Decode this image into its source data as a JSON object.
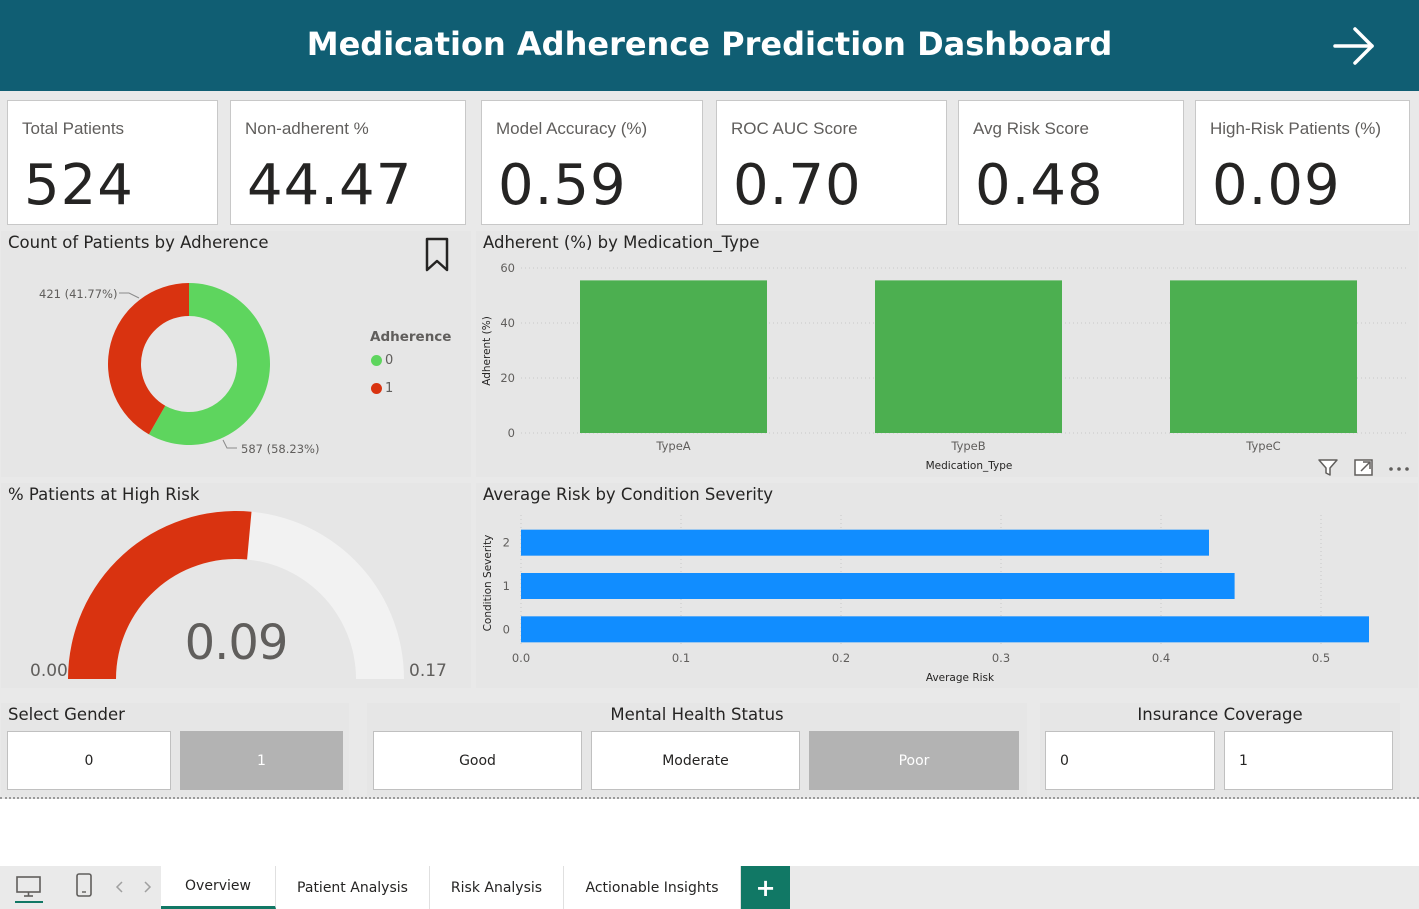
{
  "header": {
    "title": "Medication Adherence Prediction Dashboard"
  },
  "kpis": [
    {
      "label": "Total Patients",
      "value": "524"
    },
    {
      "label": "Non-adherent %",
      "value": "44.47"
    },
    {
      "label": "Model Accuracy (%)",
      "value": "0.59"
    },
    {
      "label": "ROC AUC Score",
      "value": "0.70"
    },
    {
      "label": "Avg Risk Score",
      "value": "0.48"
    },
    {
      "label": "High-Risk Patients (%)",
      "value": "0.09"
    }
  ],
  "donut": {
    "title": "Count of Patients by Adherence",
    "legend_title": "Adherence",
    "label_1": "421 (41.77%)",
    "label_0": "587 (58.23%)",
    "colors": {
      "0": "#5ed55e",
      "1": "#d93310"
    }
  },
  "gauge": {
    "title": "% Patients at High Risk",
    "value_text": "0.09",
    "min_text": "0.00",
    "max_text": "0.17"
  },
  "slicers": {
    "gender": {
      "title": "Select Gender",
      "options": [
        "0",
        "1"
      ],
      "selected": "1"
    },
    "mental": {
      "title": "Mental Health Status",
      "options": [
        "Good",
        "Moderate",
        "Poor"
      ],
      "selected": "Poor"
    },
    "insurance": {
      "title": "Insurance Coverage",
      "options": [
        "0",
        "1"
      ],
      "selected": ""
    }
  },
  "tabs": {
    "overview": "Overview",
    "patient": "Patient Analysis",
    "risk": "Risk Analysis",
    "insights": "Actionable Insights",
    "add": "+"
  },
  "icons": [
    "arrow-right-icon",
    "bookmark-icon",
    "filter-icon",
    "focus-mode-icon",
    "more-options-icon",
    "desktop-icon",
    "phone-icon",
    "chevron-left-icon",
    "chevron-right-icon"
  ],
  "chart_data": [
    {
      "type": "pie",
      "title": "Count of Patients by Adherence",
      "categories": [
        "0",
        "1"
      ],
      "values": [
        587,
        421
      ],
      "percent": [
        58.23,
        41.77
      ],
      "legend": "right",
      "colors": [
        "#5ed55e",
        "#d93310"
      ]
    },
    {
      "type": "bar",
      "title": "Adherent (%) by Medication_Type",
      "categories": [
        "TypeA",
        "TypeB",
        "TypeC"
      ],
      "values": [
        55.5,
        55.5,
        55.5
      ],
      "xlabel": "Medication_Type",
      "ylabel": "Adherent (%)",
      "ylim": [
        0,
        60
      ],
      "yticks": [
        "0",
        "20",
        "40",
        "60"
      ],
      "color": "#4caf50",
      "grid": true
    },
    {
      "type": "bar",
      "orientation": "horizontal",
      "title": "Average Risk by Condition Severity",
      "categories": [
        "2",
        "1",
        "0"
      ],
      "values": [
        0.43,
        0.446,
        0.53
      ],
      "xlabel": "Average Risk",
      "ylabel": "Condition Severity",
      "xlim": [
        0,
        0.55
      ],
      "xticks": [
        "0.0",
        "0.1",
        "0.2",
        "0.3",
        "0.4",
        "0.5"
      ],
      "color": "#118dff",
      "grid": true
    },
    {
      "type": "gauge",
      "title": "% Patients at High Risk",
      "value": 0.09,
      "min": 0,
      "max": 0.17,
      "fill_color": "#d93310",
      "track_color": "#f2f2f2"
    }
  ]
}
